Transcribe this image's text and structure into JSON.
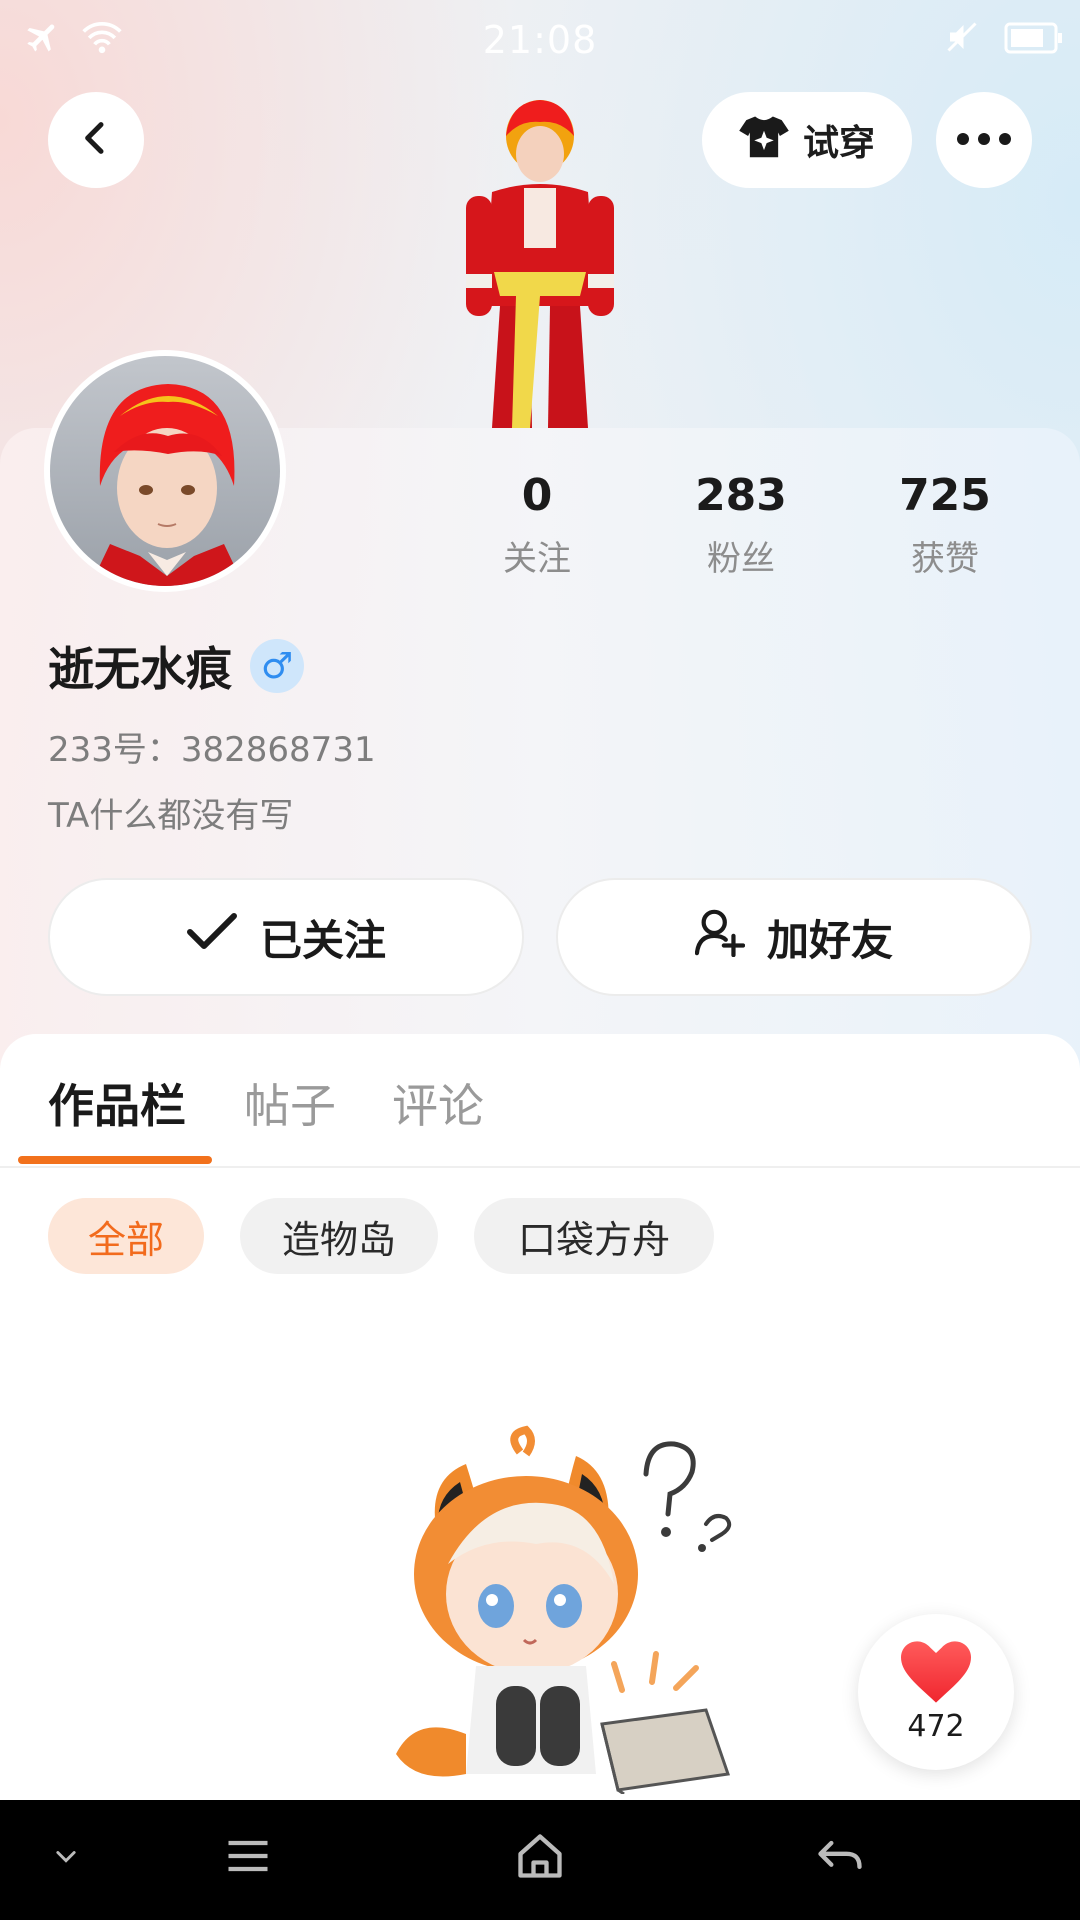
{
  "status_bar": {
    "time": "21:08",
    "icons": [
      "airplane-icon",
      "wifi-icon",
      "mute-icon",
      "battery-icon"
    ]
  },
  "header": {
    "try_on_label": "试穿",
    "icons": [
      "back-arrow-icon",
      "shirt-sparkle-icon",
      "more-dots-icon"
    ]
  },
  "profile": {
    "name": "逝无水痕",
    "gender_symbol": "♂",
    "uid": "233号：382868731",
    "bio": "TA什么都没有写",
    "stats": [
      {
        "value": "0",
        "label": "关注"
      },
      {
        "value": "283",
        "label": "粉丝"
      },
      {
        "value": "725",
        "label": "获赞"
      }
    ],
    "follow_button": "已关注",
    "add_friend_button": "加好友"
  },
  "tabs": {
    "items": [
      "作品栏",
      "帖子",
      "评论"
    ],
    "active": "作品栏"
  },
  "filters": {
    "items": [
      "全部",
      "造物岛",
      "口袋方舟"
    ],
    "active": "全部"
  },
  "like_float": {
    "count": "472"
  },
  "colors": {
    "accent": "#f2711c",
    "chip_active_bg": "#fde6d8",
    "gender_blue": "#2f8df0"
  },
  "nav_bar": {
    "icons": [
      "collapse-chevron-icon",
      "menu-icon",
      "home-icon",
      "back-icon"
    ]
  }
}
